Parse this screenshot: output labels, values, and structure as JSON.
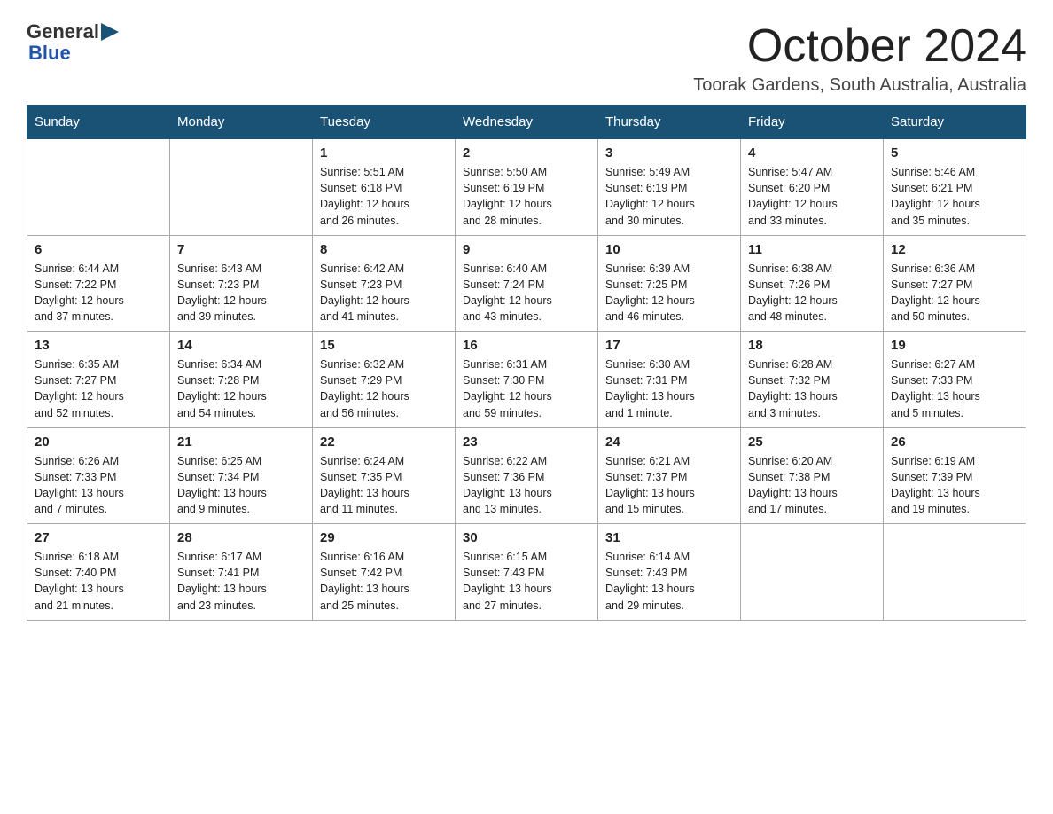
{
  "header": {
    "logo_general": "General",
    "logo_blue": "Blue",
    "month": "October 2024",
    "location": "Toorak Gardens, South Australia, Australia"
  },
  "weekdays": [
    "Sunday",
    "Monday",
    "Tuesday",
    "Wednesday",
    "Thursday",
    "Friday",
    "Saturday"
  ],
  "weeks": [
    [
      {
        "day": "",
        "info": ""
      },
      {
        "day": "",
        "info": ""
      },
      {
        "day": "1",
        "info": "Sunrise: 5:51 AM\nSunset: 6:18 PM\nDaylight: 12 hours\nand 26 minutes."
      },
      {
        "day": "2",
        "info": "Sunrise: 5:50 AM\nSunset: 6:19 PM\nDaylight: 12 hours\nand 28 minutes."
      },
      {
        "day": "3",
        "info": "Sunrise: 5:49 AM\nSunset: 6:19 PM\nDaylight: 12 hours\nand 30 minutes."
      },
      {
        "day": "4",
        "info": "Sunrise: 5:47 AM\nSunset: 6:20 PM\nDaylight: 12 hours\nand 33 minutes."
      },
      {
        "day": "5",
        "info": "Sunrise: 5:46 AM\nSunset: 6:21 PM\nDaylight: 12 hours\nand 35 minutes."
      }
    ],
    [
      {
        "day": "6",
        "info": "Sunrise: 6:44 AM\nSunset: 7:22 PM\nDaylight: 12 hours\nand 37 minutes."
      },
      {
        "day": "7",
        "info": "Sunrise: 6:43 AM\nSunset: 7:23 PM\nDaylight: 12 hours\nand 39 minutes."
      },
      {
        "day": "8",
        "info": "Sunrise: 6:42 AM\nSunset: 7:23 PM\nDaylight: 12 hours\nand 41 minutes."
      },
      {
        "day": "9",
        "info": "Sunrise: 6:40 AM\nSunset: 7:24 PM\nDaylight: 12 hours\nand 43 minutes."
      },
      {
        "day": "10",
        "info": "Sunrise: 6:39 AM\nSunset: 7:25 PM\nDaylight: 12 hours\nand 46 minutes."
      },
      {
        "day": "11",
        "info": "Sunrise: 6:38 AM\nSunset: 7:26 PM\nDaylight: 12 hours\nand 48 minutes."
      },
      {
        "day": "12",
        "info": "Sunrise: 6:36 AM\nSunset: 7:27 PM\nDaylight: 12 hours\nand 50 minutes."
      }
    ],
    [
      {
        "day": "13",
        "info": "Sunrise: 6:35 AM\nSunset: 7:27 PM\nDaylight: 12 hours\nand 52 minutes."
      },
      {
        "day": "14",
        "info": "Sunrise: 6:34 AM\nSunset: 7:28 PM\nDaylight: 12 hours\nand 54 minutes."
      },
      {
        "day": "15",
        "info": "Sunrise: 6:32 AM\nSunset: 7:29 PM\nDaylight: 12 hours\nand 56 minutes."
      },
      {
        "day": "16",
        "info": "Sunrise: 6:31 AM\nSunset: 7:30 PM\nDaylight: 12 hours\nand 59 minutes."
      },
      {
        "day": "17",
        "info": "Sunrise: 6:30 AM\nSunset: 7:31 PM\nDaylight: 13 hours\nand 1 minute."
      },
      {
        "day": "18",
        "info": "Sunrise: 6:28 AM\nSunset: 7:32 PM\nDaylight: 13 hours\nand 3 minutes."
      },
      {
        "day": "19",
        "info": "Sunrise: 6:27 AM\nSunset: 7:33 PM\nDaylight: 13 hours\nand 5 minutes."
      }
    ],
    [
      {
        "day": "20",
        "info": "Sunrise: 6:26 AM\nSunset: 7:33 PM\nDaylight: 13 hours\nand 7 minutes."
      },
      {
        "day": "21",
        "info": "Sunrise: 6:25 AM\nSunset: 7:34 PM\nDaylight: 13 hours\nand 9 minutes."
      },
      {
        "day": "22",
        "info": "Sunrise: 6:24 AM\nSunset: 7:35 PM\nDaylight: 13 hours\nand 11 minutes."
      },
      {
        "day": "23",
        "info": "Sunrise: 6:22 AM\nSunset: 7:36 PM\nDaylight: 13 hours\nand 13 minutes."
      },
      {
        "day": "24",
        "info": "Sunrise: 6:21 AM\nSunset: 7:37 PM\nDaylight: 13 hours\nand 15 minutes."
      },
      {
        "day": "25",
        "info": "Sunrise: 6:20 AM\nSunset: 7:38 PM\nDaylight: 13 hours\nand 17 minutes."
      },
      {
        "day": "26",
        "info": "Sunrise: 6:19 AM\nSunset: 7:39 PM\nDaylight: 13 hours\nand 19 minutes."
      }
    ],
    [
      {
        "day": "27",
        "info": "Sunrise: 6:18 AM\nSunset: 7:40 PM\nDaylight: 13 hours\nand 21 minutes."
      },
      {
        "day": "28",
        "info": "Sunrise: 6:17 AM\nSunset: 7:41 PM\nDaylight: 13 hours\nand 23 minutes."
      },
      {
        "day": "29",
        "info": "Sunrise: 6:16 AM\nSunset: 7:42 PM\nDaylight: 13 hours\nand 25 minutes."
      },
      {
        "day": "30",
        "info": "Sunrise: 6:15 AM\nSunset: 7:43 PM\nDaylight: 13 hours\nand 27 minutes."
      },
      {
        "day": "31",
        "info": "Sunrise: 6:14 AM\nSunset: 7:43 PM\nDaylight: 13 hours\nand 29 minutes."
      },
      {
        "day": "",
        "info": ""
      },
      {
        "day": "",
        "info": ""
      }
    ]
  ]
}
